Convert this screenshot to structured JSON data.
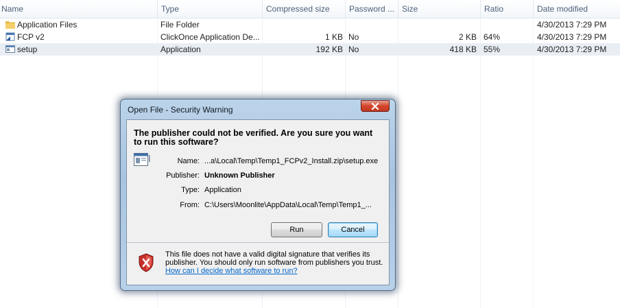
{
  "columns": [
    "Name",
    "Type",
    "Compressed size",
    "Password ...",
    "Size",
    "Ratio",
    "Date modified"
  ],
  "files": [
    {
      "name": "Application Files",
      "icon": "folder-icon",
      "type": "File Folder",
      "compressed": "",
      "password": "",
      "size": "",
      "ratio": "",
      "date": "4/30/2013 7:29 PM"
    },
    {
      "name": "FCP v2",
      "icon": "clickonce-icon",
      "type": "ClickOnce Application De...",
      "compressed": "1 KB",
      "password": "No",
      "size": "2 KB",
      "ratio": "64%",
      "date": "4/30/2013 7:29 PM"
    },
    {
      "name": "setup",
      "icon": "application-icon",
      "type": "Application",
      "compressed": "192 KB",
      "password": "No",
      "size": "418 KB",
      "ratio": "55%",
      "date": "4/30/2013 7:29 PM"
    }
  ],
  "dialog": {
    "title": "Open File - Security Warning",
    "question": "The publisher could not be verified.  Are you sure you want to run this software?",
    "fields": [
      {
        "label": "Name:",
        "value": "...a\\Local\\Temp\\Temp1_FCPv2_Install.zip\\setup.exe"
      },
      {
        "label": "Publisher:",
        "value": "Unknown Publisher"
      },
      {
        "label": "Type:",
        "value": "Application"
      },
      {
        "label": "From:",
        "value": "C:\\Users\\Moonlite\\AppData\\Local\\Temp\\Temp1_..."
      }
    ],
    "run_label": "Run",
    "cancel_label": "Cancel",
    "warning_text": "This file does not have a valid digital signature that verifies its publisher.  You should only run software from publishers you trust.",
    "help_link": "How can I decide what software to run?"
  },
  "colors": {
    "selection": "#e9eef5",
    "link": "#0066cc",
    "close": "#c23a22"
  }
}
